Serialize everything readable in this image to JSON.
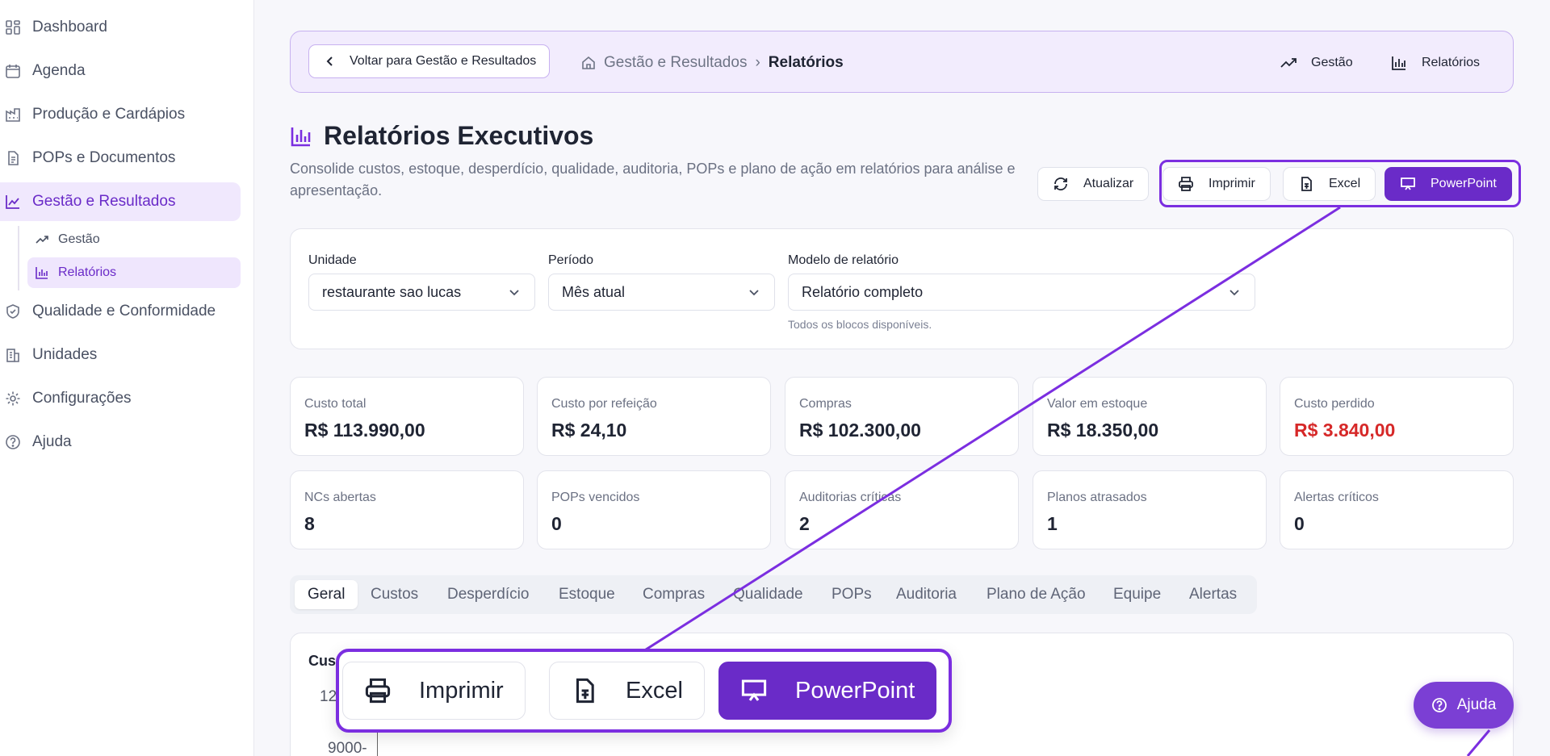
{
  "sidebar": {
    "items": [
      {
        "label": "Dashboard",
        "icon": "grid-icon"
      },
      {
        "label": "Agenda",
        "icon": "calendar-icon"
      },
      {
        "label": "Produção e Cardápios",
        "icon": "factory-icon"
      },
      {
        "label": "POPs e Documentos",
        "icon": "document-icon"
      },
      {
        "label": "Gestão e Resultados",
        "icon": "line-chart-icon",
        "active": true
      },
      {
        "label": "Qualidade e Conformidade",
        "icon": "shield-check-icon"
      },
      {
        "label": "Unidades",
        "icon": "building-icon"
      },
      {
        "label": "Configurações",
        "icon": "gear-icon"
      },
      {
        "label": "Ajuda",
        "icon": "help-circle-icon"
      }
    ],
    "subitems": [
      {
        "label": "Gestão",
        "icon": "trend-up-icon"
      },
      {
        "label": "Relatórios",
        "icon": "bar-chart-icon",
        "active": true
      }
    ]
  },
  "topbar": {
    "back_label": "Voltar para Gestão e Resultados",
    "breadcrumb_parent": "Gestão e Resultados",
    "breadcrumb_separator": "›",
    "breadcrumb_current": "Relatórios",
    "link_gestao": "Gestão",
    "link_relatorios": "Relatórios"
  },
  "page": {
    "title": "Relatórios Executivos",
    "subtitle": "Consolide custos, estoque, desperdício, qualidade, auditoria, POPs e plano de ação em relatórios para análise e apresentação."
  },
  "actions": {
    "refresh": "Atualizar",
    "print": "Imprimir",
    "excel": "Excel",
    "powerpoint": "PowerPoint"
  },
  "filters": {
    "unit_label": "Unidade",
    "unit_value": "restaurante sao lucas",
    "period_label": "Período",
    "period_value": "Mês atual",
    "model_label": "Modelo de relatório",
    "model_value": "Relatório completo",
    "model_hint": "Todos os blocos disponíveis."
  },
  "kpis": [
    {
      "label": "Custo total",
      "value": "R$ 113.990,00"
    },
    {
      "label": "Custo por refeição",
      "value": "R$ 24,10"
    },
    {
      "label": "Compras",
      "value": "R$ 102.300,00"
    },
    {
      "label": "Valor em estoque",
      "value": "R$ 18.350,00"
    },
    {
      "label": "Custo perdido",
      "value": "R$ 3.840,00",
      "color": "#d62828"
    },
    {
      "label": "NCs abertas",
      "value": "8"
    },
    {
      "label": "POPs vencidos",
      "value": "0"
    },
    {
      "label": "Auditorias críticas",
      "value": "2"
    },
    {
      "label": "Planos atrasados",
      "value": "1"
    },
    {
      "label": "Alertas críticos",
      "value": "0"
    }
  ],
  "tabs": [
    "Geral",
    "Custos",
    "Desperdício",
    "Estoque",
    "Compras",
    "Qualidade",
    "POPs",
    "Auditoria",
    "Plano de Ação",
    "Equipe",
    "Alertas"
  ],
  "chart": {
    "title_partial": "Cus",
    "tick_top_partial": "12",
    "tick_9000": "9000-"
  },
  "help_button": "Ajuda",
  "colors": {
    "accent": "#6a2bc8",
    "highlight": "#7b2ee0",
    "danger": "#d62828"
  }
}
